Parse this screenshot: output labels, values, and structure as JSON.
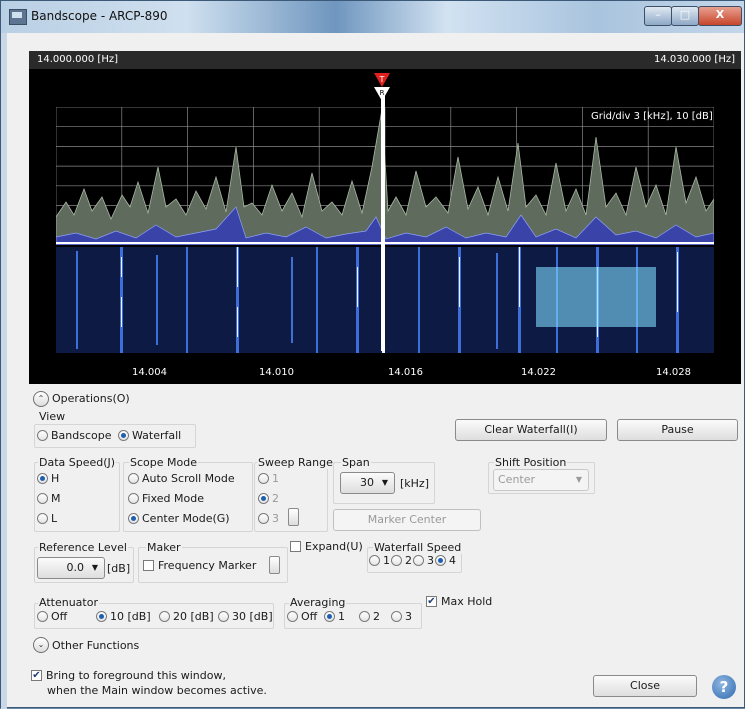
{
  "window": {
    "title": "Bandscope - ARCP-890",
    "minimize": "–",
    "maximize": "□",
    "close": "X"
  },
  "scope": {
    "freq_start": "14.000.000 [Hz]",
    "freq_end": "14.030.000 [Hz]",
    "grid_label": "Grid/div 3 [kHz], 10 [dB]",
    "marker_t": "T",
    "marker_r": "R",
    "ticks": [
      "14.004",
      "14.010",
      "14.016",
      "14.022",
      "14.028"
    ]
  },
  "operations": {
    "label": "Operations(O)"
  },
  "view": {
    "label": "View",
    "options": [
      "Bandscope",
      "Waterfall"
    ],
    "selected": "Waterfall"
  },
  "buttons": {
    "clear_waterfall": "Clear Waterfall(I)",
    "pause": "Pause",
    "marker_center": "Marker Center",
    "close": "Close",
    "help": "?"
  },
  "data_speed": {
    "label": "Data Speed(J)",
    "options": [
      "H",
      "M",
      "L"
    ],
    "selected": "H"
  },
  "scope_mode": {
    "label": "Scope Mode",
    "options": [
      "Auto Scroll Mode",
      "Fixed Mode",
      "Center Mode(G)"
    ],
    "selected": "Center Mode(G)"
  },
  "sweep_range": {
    "label": "Sweep Range",
    "options": [
      "1",
      "2",
      "3"
    ],
    "selected": "2"
  },
  "span": {
    "label": "Span",
    "value": "30",
    "unit": "[kHz]"
  },
  "shift_position": {
    "label": "Shift Position",
    "value": "Center"
  },
  "reference_level": {
    "label": "Reference Level",
    "value": "0.0",
    "unit": "[dB]"
  },
  "maker": {
    "label": "Maker",
    "frequency_marker": "Frequency Marker"
  },
  "expand": {
    "label": "Expand(U)"
  },
  "waterfall_speed": {
    "label": "Waterfall Speed",
    "options": [
      "1",
      "2",
      "3",
      "4"
    ],
    "selected": "4"
  },
  "attenuator": {
    "label": "Attenuator",
    "options": [
      "Off",
      "10 [dB]",
      "20 [dB]",
      "30 [dB]"
    ],
    "selected": "10 [dB]"
  },
  "averaging": {
    "label": "Averaging",
    "options": [
      "Off",
      "1",
      "2",
      "3"
    ],
    "selected": "1"
  },
  "max_hold": {
    "label": "Max Hold",
    "checked": true
  },
  "other_functions": {
    "label": "Other Functions"
  },
  "foreground": {
    "line1": "Bring to foreground this window,",
    "line2": "when the Main window becomes active.",
    "checked": true
  }
}
